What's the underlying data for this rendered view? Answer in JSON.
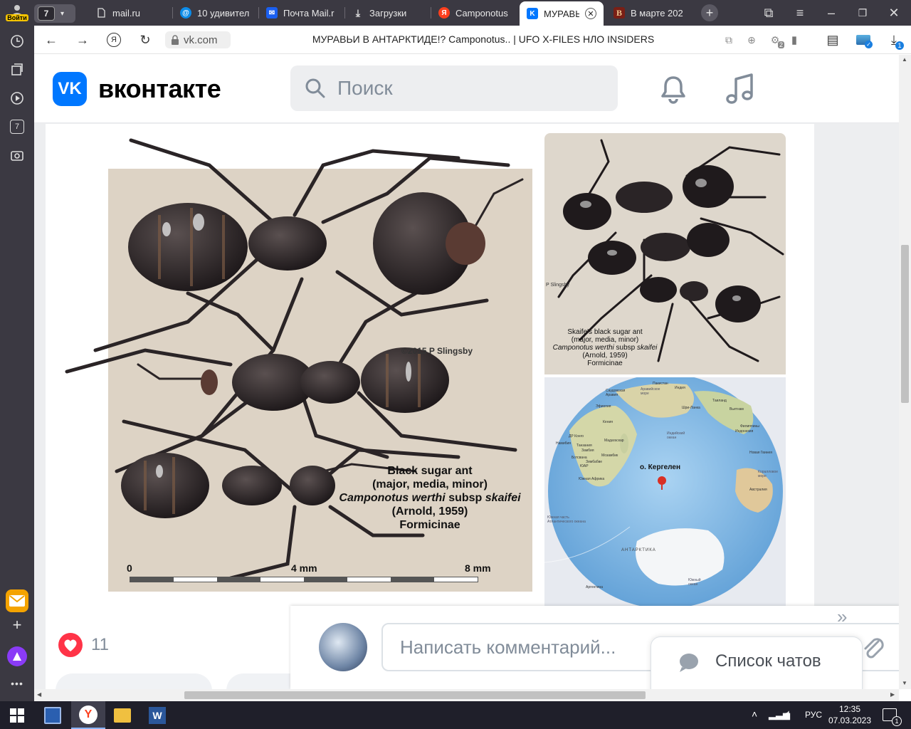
{
  "browser": {
    "profile_label": "Войти",
    "tab_count": "7",
    "tabs": [
      {
        "title": "mail.ru"
      },
      {
        "title": "10 удивител"
      },
      {
        "title": "Почта Mail.r"
      },
      {
        "title": "Загрузки"
      },
      {
        "title": "Camponotus"
      },
      {
        "title": "МУРАВЬИ"
      },
      {
        "title": "В марте 202"
      }
    ],
    "address_domain": "vk.com",
    "page_title": "МУРАВЬИ В АНТАРКТИДЕ!? Camponotus.. | UFO X-FILES НЛО INSIDERS",
    "badge_tabs": "2",
    "badge_downloads": "1",
    "sidebar_badge": "7"
  },
  "vk": {
    "logo_text": "вконтакте",
    "search_placeholder": "Поиск"
  },
  "image_left": {
    "copyright": "©2015 P Slingsby",
    "caption_line1": "Black sugar ant",
    "caption_line2": "(major, media, minor)",
    "caption_genus": "Camponotus werthi",
    "caption_subsp": "subsp",
    "caption_species": "skaifei",
    "caption_line4": "(Arnold, 1959)",
    "caption_line5": "Formicinae",
    "scale_0": "0",
    "scale_4": "4 mm",
    "scale_8": "8 mm"
  },
  "image_right_top": {
    "credit": "P Slingsby",
    "caption_line1": "Skaife's black sugar ant",
    "caption_line2": "(major, media, minor)",
    "caption_genus": "Camponotus werthi",
    "caption_subsp": "subsp",
    "caption_species": "skaifei",
    "caption_line4": "(Arnold, 1959)",
    "caption_line5": "Formicinae"
  },
  "map": {
    "pin_label": "о. Кергелен",
    "labels": [
      "Пакистан",
      "Индия",
      "Саудовская Аравия",
      "Аравийское море",
      "Таиланд",
      "Эфиопия",
      "Шри-Ланка",
      "Вьетнам",
      "Кения",
      "Филиппины",
      "ДР Конго",
      "Индонезия",
      "Танзания",
      "Мадагаскар",
      "Индийский океан",
      "Намибия",
      "Замбия",
      "Новая Гвинея",
      "ЮАР",
      "Ботсвана",
      "Зимбабве",
      "Мозамбик",
      "Австралия",
      "Коралловое море",
      "Южная Африка",
      "Южная часть Атлантического океана",
      "АНТАРКТИКА",
      "Аргентина",
      "Южный океан"
    ]
  },
  "actions": {
    "likes": "11"
  },
  "comment": {
    "placeholder": "Написать комментарий...",
    "chats_label": "Список чатов"
  },
  "taskbar": {
    "lang": "РУС",
    "time": "12:35",
    "date": "07.03.2023",
    "notif": "1"
  },
  "colors": {
    "vk_blue": "#0077ff",
    "like_red": "#ff3347",
    "browser_dark": "#3b3942",
    "taskbar": "#1f1f2a"
  }
}
